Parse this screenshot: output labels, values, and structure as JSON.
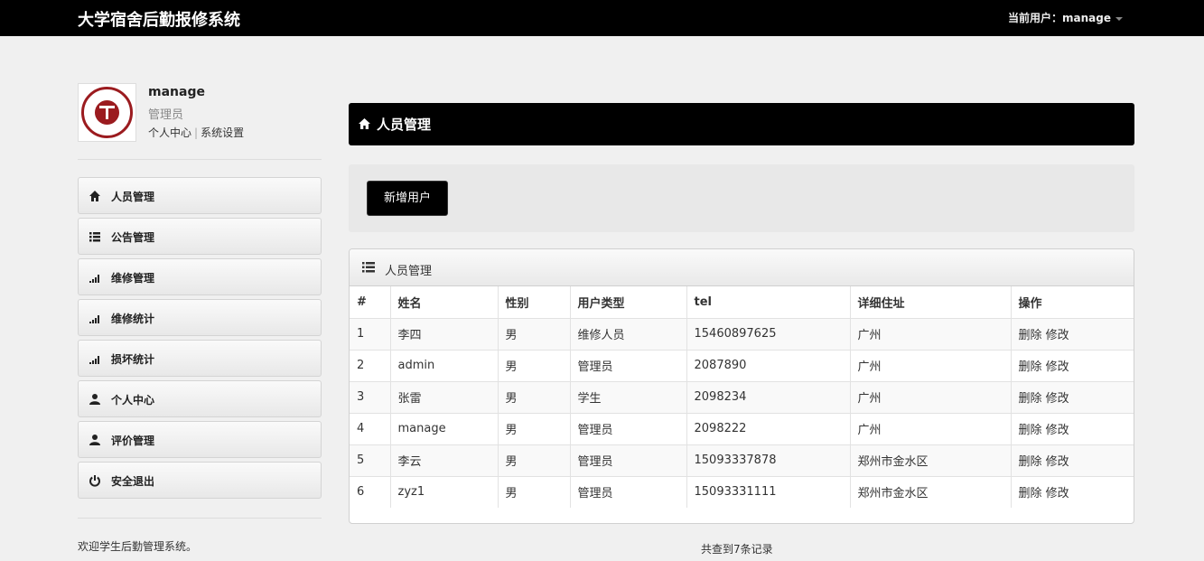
{
  "app": {
    "title": "大学宿舍后勤报修系统",
    "current_user": "当前用户：manage"
  },
  "profile": {
    "name": "manage",
    "role": "管理员",
    "link_personal": "个人中心",
    "link_sep": "|",
    "link_settings": "系统设置"
  },
  "sidebar": {
    "items": [
      {
        "label": "人员管理",
        "icon": "home-icon"
      },
      {
        "label": "公告管理",
        "icon": "list-icon"
      },
      {
        "label": "维修管理",
        "icon": "signal-bars-icon"
      },
      {
        "label": "维修统计",
        "icon": "signal-bars-icon"
      },
      {
        "label": "损坏统计",
        "icon": "signal-bars-icon"
      },
      {
        "label": "个人中心",
        "icon": "user-icon"
      },
      {
        "label": "评价管理",
        "icon": "user-icon"
      },
      {
        "label": "安全退出",
        "icon": "power-icon"
      }
    ]
  },
  "main": {
    "header_title": "人员管理",
    "add_button": "新增用户",
    "panel_title": "人员管理",
    "columns": [
      "#",
      "姓名",
      "性别",
      "用户类型",
      "tel",
      "详细住址",
      "操作"
    ],
    "rows": [
      {
        "id": "1",
        "name": "李四",
        "gender": "男",
        "type": "维修人员",
        "tel": "15460897625",
        "address": "广州"
      },
      {
        "id": "2",
        "name": "admin",
        "gender": "男",
        "type": "管理员",
        "tel": "2087890",
        "address": "广州"
      },
      {
        "id": "3",
        "name": "张雷",
        "gender": "男",
        "type": "学生",
        "tel": "2098234",
        "address": "广州"
      },
      {
        "id": "4",
        "name": "manage",
        "gender": "男",
        "type": "管理员",
        "tel": "2098222",
        "address": "广州"
      },
      {
        "id": "5",
        "name": "李云",
        "gender": "男",
        "type": "管理员",
        "tel": "15093337878",
        "address": "郑州市金水区"
      },
      {
        "id": "6",
        "name": "zyz1",
        "gender": "男",
        "type": "管理员",
        "tel": "15093331111",
        "address": "郑州市金水区"
      }
    ],
    "action_delete": "删除",
    "action_edit": "修改",
    "total_text": "共查到7条记录"
  },
  "footer": {
    "welcome": "欢迎学生后勤管理系统。"
  },
  "colors": {
    "topbar": "#000000",
    "page_bg": "#f0f0f0",
    "seal": "#9b1b1f"
  }
}
